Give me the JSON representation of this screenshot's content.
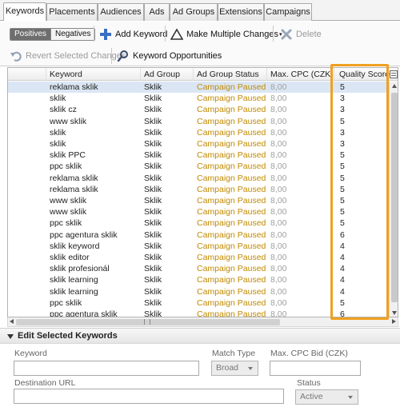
{
  "tabs": [
    {
      "label": "Keywords",
      "active": true
    },
    {
      "label": "Placements",
      "active": false
    },
    {
      "label": "Audiences",
      "active": false
    },
    {
      "label": "Ads",
      "active": false
    },
    {
      "label": "Ad Groups",
      "active": false
    },
    {
      "label": "Extensions",
      "active": false
    },
    {
      "label": "Campaigns",
      "active": false
    }
  ],
  "toolbar": {
    "positives_label": "Positives",
    "negatives_label": "Negatives",
    "add_keyword_label": "Add Keyword",
    "make_multiple_changes_label": "Make Multiple Changes",
    "delete_label": "Delete",
    "revert_label": "Revert Selected Changes",
    "keyword_opportunities_label": "Keyword Opportunities"
  },
  "grid": {
    "columns": {
      "keyword": "Keyword",
      "ad_group": "Ad Group",
      "ad_group_status": "Ad Group Status",
      "max_cpc": "Max. CPC (CZK)",
      "quality_score": "Quality Score"
    },
    "rows": [
      {
        "keyword": "reklama sklik",
        "ad_group": "Sklik",
        "status": "Campaign Paused",
        "cpc": "8,00",
        "qs": "5"
      },
      {
        "keyword": "sklik",
        "ad_group": "Sklik",
        "status": "Campaign Paused",
        "cpc": "8,00",
        "qs": "3"
      },
      {
        "keyword": "sklik cz",
        "ad_group": "Sklik",
        "status": "Campaign Paused",
        "cpc": "8,00",
        "qs": "3"
      },
      {
        "keyword": "www sklik",
        "ad_group": "Sklik",
        "status": "Campaign Paused",
        "cpc": "8,00",
        "qs": "5"
      },
      {
        "keyword": "sklik",
        "ad_group": "Sklik",
        "status": "Campaign Paused",
        "cpc": "8,00",
        "qs": "3"
      },
      {
        "keyword": "sklik",
        "ad_group": "Sklik",
        "status": "Campaign Paused",
        "cpc": "8,00",
        "qs": "3"
      },
      {
        "keyword": "sklik PPC",
        "ad_group": "Sklik",
        "status": "Campaign Paused",
        "cpc": "8,00",
        "qs": "5"
      },
      {
        "keyword": "ppc sklik",
        "ad_group": "Sklik",
        "status": "Campaign Paused",
        "cpc": "8,00",
        "qs": "5"
      },
      {
        "keyword": "reklama sklik",
        "ad_group": "Sklik",
        "status": "Campaign Paused",
        "cpc": "8,00",
        "qs": "5"
      },
      {
        "keyword": "reklama sklik",
        "ad_group": "Sklik",
        "status": "Campaign Paused",
        "cpc": "8,00",
        "qs": "5"
      },
      {
        "keyword": "www sklik",
        "ad_group": "Sklik",
        "status": "Campaign Paused",
        "cpc": "8,00",
        "qs": "5"
      },
      {
        "keyword": "www sklik",
        "ad_group": "Sklik",
        "status": "Campaign Paused",
        "cpc": "8,00",
        "qs": "5"
      },
      {
        "keyword": "ppc sklik",
        "ad_group": "Sklik",
        "status": "Campaign Paused",
        "cpc": "8,00",
        "qs": "5"
      },
      {
        "keyword": "ppc agentura sklik",
        "ad_group": "Sklik",
        "status": "Campaign Paused",
        "cpc": "8,00",
        "qs": "6"
      },
      {
        "keyword": "sklik keyword",
        "ad_group": "Sklik",
        "status": "Campaign Paused",
        "cpc": "8,00",
        "qs": "4"
      },
      {
        "keyword": "sklik editor",
        "ad_group": "Sklik",
        "status": "Campaign Paused",
        "cpc": "8,00",
        "qs": "4"
      },
      {
        "keyword": "sklik profesionál",
        "ad_group": "Sklik",
        "status": "Campaign Paused",
        "cpc": "8,00",
        "qs": "4"
      },
      {
        "keyword": "sklik learning",
        "ad_group": "Sklik",
        "status": "Campaign Paused",
        "cpc": "8,00",
        "qs": "4"
      },
      {
        "keyword": "sklik learning",
        "ad_group": "Sklik",
        "status": "Campaign Paused",
        "cpc": "8,00",
        "qs": "4"
      },
      {
        "keyword": "ppc sklik",
        "ad_group": "Sklik",
        "status": "Campaign Paused",
        "cpc": "8,00",
        "qs": "5"
      },
      {
        "keyword": "ppc agentura sklik",
        "ad_group": "Sklik",
        "status": "Campaign Paused",
        "cpc": "8,00",
        "qs": "6"
      }
    ]
  },
  "edit_panel": {
    "title": "Edit Selected Keywords",
    "keyword_label": "Keyword",
    "keyword_value": "",
    "match_type_label": "Match Type",
    "match_type_value": "Broad",
    "max_cpc_bid_label": "Max. CPC Bid (CZK)",
    "max_cpc_bid_value": "",
    "destination_url_label": "Destination URL",
    "destination_url_value": "",
    "status_label": "Status",
    "status_value": "Active"
  },
  "colors": {
    "status_text": "#c18a00",
    "highlight": "#f0a020",
    "selected_row": "#dbe6f4"
  }
}
